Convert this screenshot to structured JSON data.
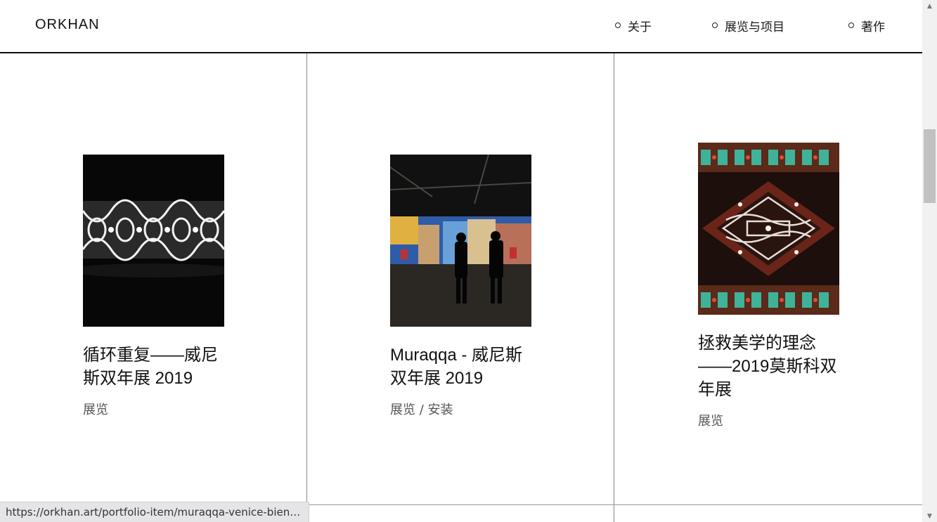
{
  "site": {
    "logo": "ORKHAN"
  },
  "nav": [
    {
      "label": "关于"
    },
    {
      "label": "展览与项目"
    },
    {
      "label": "著作"
    }
  ],
  "cards": [
    {
      "title": "循环重复——威尼斯双年展 2019",
      "category": "展览"
    },
    {
      "title": "Muraqqa - 威尼斯双年展 2019",
      "category": "展览 / 安装"
    },
    {
      "title": "拯救美学的理念——2019莫斯科双年展",
      "category": "展览"
    }
  ],
  "status_bar": {
    "url": "https://orkhan.art/portfolio-item/muraqqa-venice-bienna..."
  },
  "colors": {
    "divider": "#888888",
    "header_rule": "#111111"
  }
}
